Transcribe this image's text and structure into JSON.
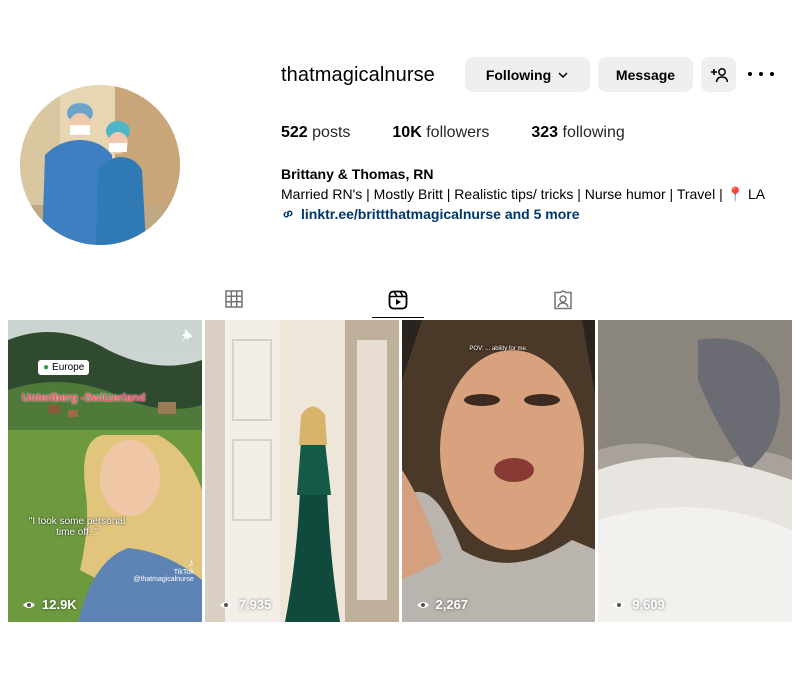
{
  "profile": {
    "username": "thatmagicalnurse",
    "full_name": "Brittany & Thomas, RN",
    "bio": "Married RN's | Mostly Britt | Realistic tips/ tricks | Nurse humor | Travel | ",
    "bio_location_emoji": "📍",
    "bio_location": "LA",
    "link": "linktr.ee/brittthatmagicalnurse and 5 more"
  },
  "actions": {
    "following_label": "Following",
    "message_label": "Message"
  },
  "stats": {
    "posts_count": "522",
    "posts_label": "posts",
    "followers_count": "10K",
    "followers_label": "followers",
    "following_count": "323",
    "following_label": "following"
  },
  "tabs": [
    {
      "name": "grid",
      "icon": "grid-icon",
      "active": false
    },
    {
      "name": "reels",
      "icon": "reels-icon",
      "active": true
    },
    {
      "name": "tagged",
      "icon": "tagged-icon",
      "active": false
    }
  ],
  "reels": [
    {
      "views": "12.9K",
      "tag": "Europe",
      "location": "Unteriberg -Switzerland",
      "caption": "\"I took some personal time off..\"",
      "watermark": "TikTok",
      "watermark_handle": "@thatmagicalnurse",
      "pinned": true
    },
    {
      "views": "7,935"
    },
    {
      "views": "2,267",
      "caption_top": "POV: ... ability for me."
    },
    {
      "views": "9,609"
    }
  ],
  "colors": {
    "button_bg": "#efefef",
    "link": "#00376b",
    "pin": "#d6226b"
  }
}
